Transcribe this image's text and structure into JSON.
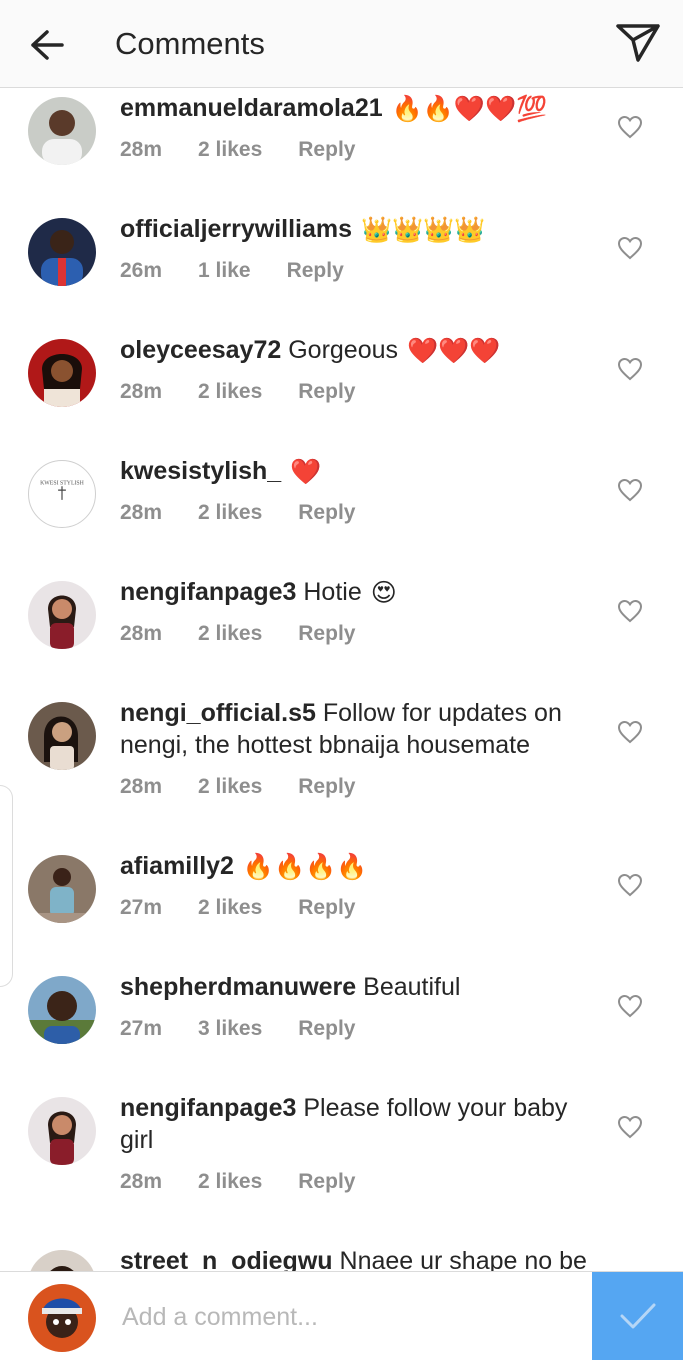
{
  "header": {
    "title": "Comments"
  },
  "comments": [
    {
      "username": "emmanueldaramola21",
      "text": "",
      "emojis": "🔥🔥❤️❤️💯",
      "time": "28m",
      "likes": "2 likes",
      "reply": "Reply"
    },
    {
      "username": "officialjerrywilliams",
      "text": "",
      "emojis": "👑👑👑👑",
      "time": "26m",
      "likes": "1 like",
      "reply": "Reply"
    },
    {
      "username": "oleyceesay72",
      "text": "Gorgeous",
      "emojis": "❤️❤️❤️",
      "time": "28m",
      "likes": "2 likes",
      "reply": "Reply"
    },
    {
      "username": "kwesistylish_",
      "text": "",
      "emojis": "❤️",
      "time": "28m",
      "likes": "2 likes",
      "reply": "Reply",
      "avatar_text": "KWESI STYLISH"
    },
    {
      "username": "nengifanpage3",
      "text": "Hotie",
      "emojis": "😍",
      "time": "28m",
      "likes": "2 likes",
      "reply": "Reply"
    },
    {
      "username": "nengi_official.s5",
      "text": "Follow for updates on nengi, the hottest bbnaija housemate",
      "emojis": "",
      "time": "28m",
      "likes": "2 likes",
      "reply": "Reply"
    },
    {
      "username": "afiamilly2",
      "text": "",
      "emojis": "🔥🔥🔥🔥",
      "time": "27m",
      "likes": "2 likes",
      "reply": "Reply"
    },
    {
      "username": "shepherdmanuwere",
      "text": "Beautiful",
      "emojis": "",
      "time": "27m",
      "likes": "3 likes",
      "reply": "Reply"
    },
    {
      "username": "nengifanpage3",
      "text": "Please follow your baby girl",
      "emojis": "",
      "time": "28m",
      "likes": "2 likes",
      "reply": "Reply"
    },
    {
      "username": "street_n_odiegwu",
      "text": "Nnaee ur shape no be",
      "emojis": "",
      "time": "",
      "likes": "",
      "reply": ""
    }
  ],
  "composer": {
    "placeholder": "Add a comment..."
  },
  "colors": {
    "accent": "#3897f0",
    "muted": "#8e8e8e",
    "text": "#262626"
  },
  "icons": {
    "back": "arrow-left-icon",
    "send": "paper-plane-icon",
    "like": "heart-outline-icon",
    "post": "checkmark-icon"
  }
}
